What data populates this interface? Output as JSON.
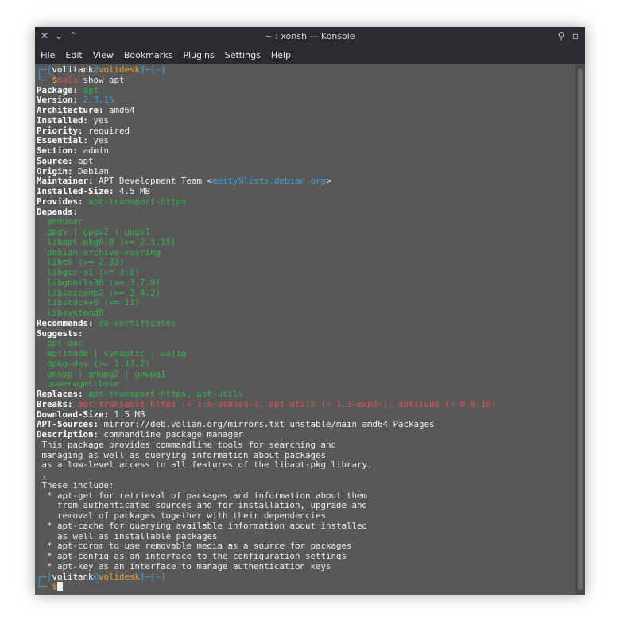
{
  "window": {
    "title": "~ : xonsh — Konsole",
    "left_buttons": [
      "✕",
      "⌄",
      "⌃"
    ],
    "right_buttons": [
      "⚲",
      "▫"
    ]
  },
  "menu": [
    "File",
    "Edit",
    "View",
    "Bookmarks",
    "Plugins",
    "Settings",
    "Help"
  ],
  "prompt": {
    "user": "volitank",
    "host": "volidesk",
    "dir": "~",
    "cmd1": "nala",
    "cmd_rest": " show apt"
  },
  "terminal": {
    "package": "apt",
    "version": "2.3.15",
    "architecture": "amd64",
    "installed": "yes",
    "priority": "required",
    "essential": "yes",
    "section": "admin",
    "source": "apt",
    "origin": "Debian",
    "maintainer_name": "APT Development Team",
    "maintainer_email": "deity@lists.debian.org",
    "installed_size": "4.5 MB",
    "provides": "apt-transport-https",
    "depends": [
      "adduser",
      "gpgv | gpgv2 | gpgv1",
      "libapt-pkg6.0 (>= 2.3.15)",
      "debian-archive-keyring",
      "libc6 (>= 2.33)",
      "libgcc-s1 (>= 3.0)",
      "libgnutls30 (>= 3.7.0)",
      "libseccomp2 (>= 2.4.2)",
      "libstdc++6 (>= 11)",
      "libsystemd0"
    ],
    "recommends": "ca-certificates",
    "suggests": [
      "apt-doc",
      "aptitude | synaptic | wajig",
      "dpkg-dev (>= 1.17.2)",
      "gnupg | gnupg2 | gnupg1",
      "powermgmt-base"
    ],
    "replaces": "apt-transport-https, apt-utils",
    "breaks": "apt-transport-https (< 1.5~alpha4~), apt-utils (< 1.3~exp2~), aptitude (< 0.8.10)",
    "download_size": "1.5 MB",
    "apt_sources": "mirror://deb.volian.org/mirrors.txt unstable/main amd64 Packages",
    "description_title": "commandline package manager",
    "description_lines": [
      " This package provides commandline tools for searching and",
      " managing as well as querying information about packages",
      " as a low-level access to all features of the libapt-pkg library.",
      " .",
      " These include:",
      "  * apt-get for retrieval of packages and information about them",
      "    from authenticated sources and for installation, upgrade and",
      "    removal of packages together with their dependencies",
      "  * apt-cache for querying available information about installed",
      "    as well as installable packages",
      "  * apt-cdrom to use removable media as a source for packages",
      "  * apt-config as an interface to the configuration settings",
      "  * apt-key as an interface to manage authentication keys"
    ]
  }
}
